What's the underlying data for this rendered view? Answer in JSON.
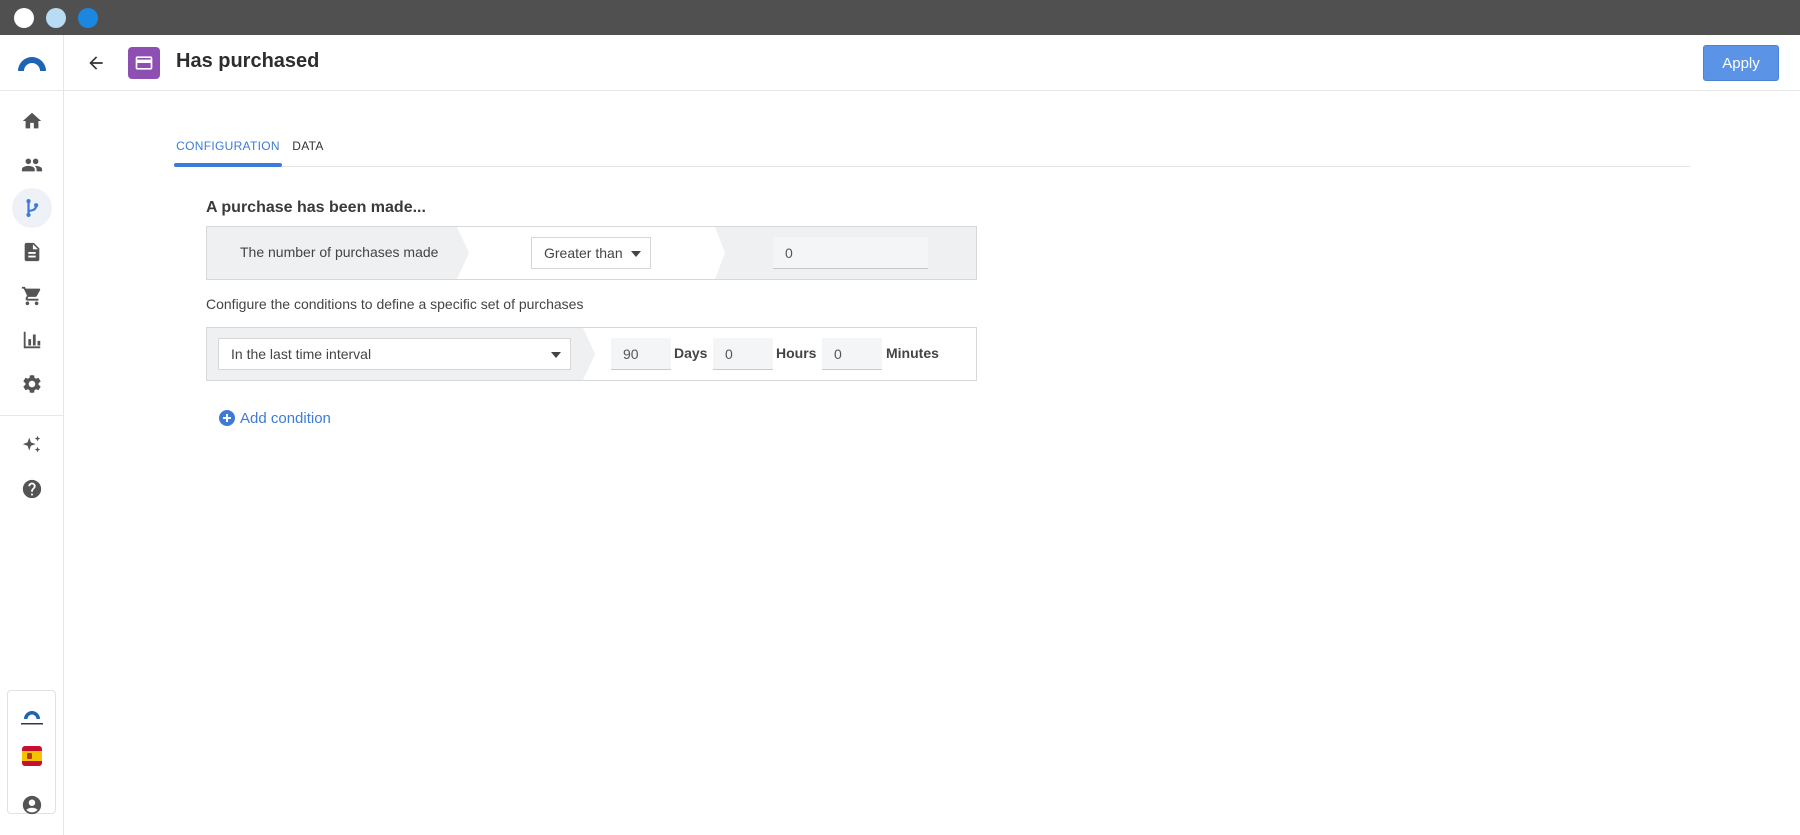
{
  "window": {
    "controls": [
      "close",
      "minimize",
      "maximize"
    ]
  },
  "sidebar": {
    "items": [
      {
        "name": "home",
        "icon": "home-icon"
      },
      {
        "name": "contacts",
        "icon": "people-icon"
      },
      {
        "name": "workflows",
        "icon": "flow-icon",
        "active": true
      },
      {
        "name": "content",
        "icon": "document-icon"
      },
      {
        "name": "purchases",
        "icon": "cart-icon"
      },
      {
        "name": "analytics",
        "icon": "bar-chart-icon"
      },
      {
        "name": "settings",
        "icon": "gear-icon"
      },
      {
        "name": "ai",
        "icon": "sparkles-icon"
      },
      {
        "name": "help",
        "icon": "help-icon"
      }
    ],
    "language_flag": "es",
    "account_icon": "account-icon"
  },
  "header": {
    "title": "Has purchased",
    "node_icon": "credit-card-icon",
    "node_color": "#8e4fb2",
    "apply_label": "Apply"
  },
  "tabs": [
    {
      "label": "CONFIGURATION",
      "active": true
    },
    {
      "label": "DATA",
      "active": false
    }
  ],
  "main": {
    "section_title": "A purchase has been made...",
    "purchase_condition": {
      "label": "The number of purchases made",
      "operator": "Greater than",
      "value": "0"
    },
    "helper_text": "Configure the conditions to define a specific set of purchases",
    "time_condition": {
      "mode": "In the last time interval",
      "days": "90",
      "days_label": "Days",
      "hours": "0",
      "hours_label": "Hours",
      "minutes": "0",
      "minutes_label": "Minutes"
    },
    "add_condition_label": "Add condition"
  },
  "colors": {
    "accent": "#3d7bd8",
    "apply_button": "#5b93e6",
    "titlebar": "#505050"
  }
}
